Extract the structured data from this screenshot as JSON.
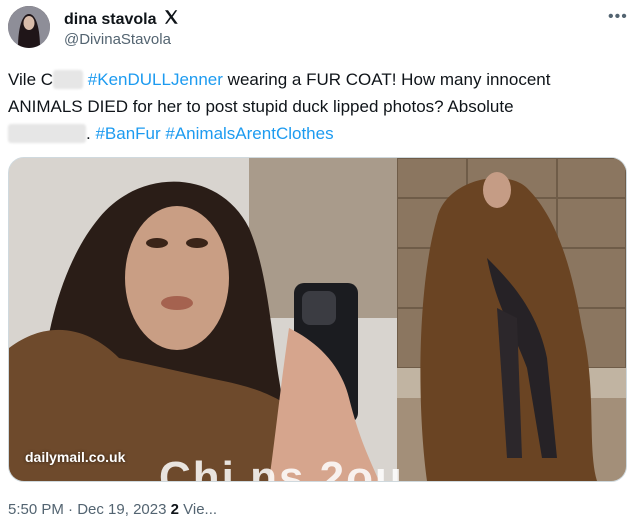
{
  "user": {
    "display_name": "dina stavola",
    "handle": "@DivinaStavola"
  },
  "tweet": {
    "line1_prefix": "Vile C",
    "line1_hashtag": "#KenDULLJenner",
    "line1_suffix": " wearing a FUR COAT! How many innocent",
    "line2": "ANIMALS DIED for her to post stupid duck lipped photos? Absolute",
    "line3_hashtag1": "#BanFur",
    "line3_hashtag2": "#AnimalsArentClothes"
  },
  "media": {
    "watermark": "dailymail.co.uk",
    "overlay_text": "Chi  ns 2ou"
  },
  "meta": {
    "time": "5:50 PM",
    "separator": " · ",
    "date": "Dec 19, 2023",
    "views_count": "2",
    "views_label": " Vie..."
  },
  "icons": {
    "verified": "x-logo-icon",
    "more": "more-options-icon"
  },
  "colors": {
    "hashtag": "#1d9bf0",
    "secondary_text": "#536471"
  }
}
